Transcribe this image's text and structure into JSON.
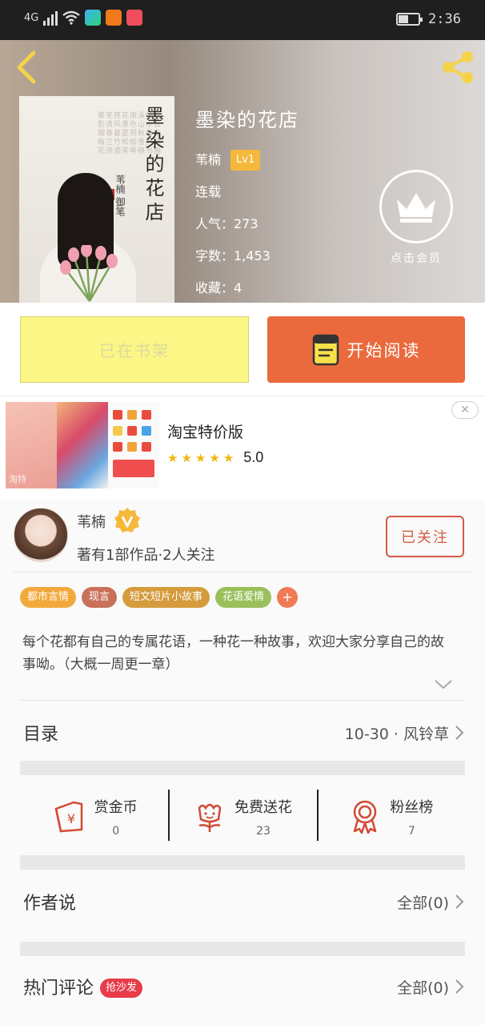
{
  "status_bar": {
    "network": "4G",
    "time": "2:36",
    "battery_level": 0.45
  },
  "book": {
    "title": "墨染的花店",
    "author": "苇楠",
    "level": "Lv1",
    "status": "连载",
    "popularity": "人气：273",
    "word_count": "字数：1,453",
    "favorites": "收藏：4",
    "cover_title": "墨染的花店",
    "cover_signature": "苇楠 御笔"
  },
  "vip": {
    "label": "点击会员"
  },
  "actions": {
    "shelf_label": "已在书架",
    "read_label": "开始阅读"
  },
  "ad": {
    "title": "淘宝特价版",
    "rating": "5.0",
    "stars": 5,
    "badge_text": "淘特"
  },
  "author": {
    "name": "苇楠",
    "stats": "著有1部作品·2人关注",
    "follow_label": "已关注",
    "tags": [
      {
        "label": "都市言情",
        "color": "#f2a93b"
      },
      {
        "label": "现言",
        "color": "#c9705a"
      },
      {
        "label": "短文短片小故事",
        "color": "#d59b3c"
      },
      {
        "label": "花语爱情",
        "color": "#9ac05c"
      }
    ],
    "tag_more": "+",
    "description": "每个花都有自己的专属花语，一种花一种故事，欢迎大家分享自己的故事呦。（大概一周更一章）"
  },
  "catalog": {
    "label": "目录",
    "latest": "10-30 · 风铃草"
  },
  "stats": [
    {
      "label": "赏金币",
      "value": "0",
      "icon": "reward-coin-icon"
    },
    {
      "label": "免费送花",
      "value": "23",
      "icon": "flower-icon"
    },
    {
      "label": "粉丝榜",
      "value": "7",
      "icon": "fan-rank-medal-icon"
    }
  ],
  "author_says": {
    "label": "作者说",
    "count": "全部(0)"
  },
  "hot_comments": {
    "label": "热门评论",
    "badge": "抢沙发",
    "count": "全部(0)"
  },
  "colors": {
    "accent_orange": "#ea6a3d",
    "shelf_yellow": "#fbf685",
    "follow_red": "#d35a44",
    "level_badge": "#f5b83a"
  }
}
